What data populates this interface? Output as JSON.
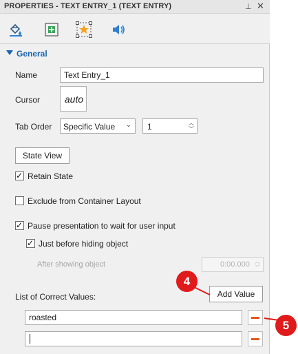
{
  "panel": {
    "title": "PROPERTIES - TEXT ENTRY_1 (TEXT ENTRY)",
    "pin_icon": "pin-icon",
    "close_icon": "close-icon",
    "close_glyph": "✕",
    "pin_glyph": "⊥"
  },
  "tabs": [
    {
      "name": "style-tab",
      "icon": "paint-bucket-icon"
    },
    {
      "name": "position-tab",
      "icon": "position-size-icon"
    },
    {
      "name": "actions-tab",
      "icon": "star-interaction-icon",
      "active": true
    },
    {
      "name": "audio-tab",
      "icon": "speaker-icon"
    }
  ],
  "general": {
    "header": "General",
    "name_label": "Name",
    "name_value": "Text Entry_1",
    "cursor_label": "Cursor",
    "cursor_value": "auto",
    "tab_order_label": "Tab Order",
    "tab_order_value": "Specific Value",
    "tab_order_number": "1",
    "state_view_label": "State View",
    "retain_state_label": "Retain State",
    "retain_state_checked": true,
    "exclude_label": "Exclude from Container Layout",
    "exclude_checked": false,
    "pause_label": "Pause presentation to wait for user input",
    "pause_checked": true,
    "before_hiding_label": "Just before hiding object",
    "before_hiding_checked": true,
    "after_showing_label": "After showing object",
    "after_showing_value": "0:00.000",
    "correct_values_label": "List of Correct Values:",
    "add_value_label": "Add Value",
    "correct_values": [
      "roasted",
      ""
    ]
  },
  "callouts": [
    "4",
    "5"
  ],
  "colors": {
    "accent": "#1a64b0",
    "callout": "#e01b1b",
    "remove": "#e2561f"
  }
}
